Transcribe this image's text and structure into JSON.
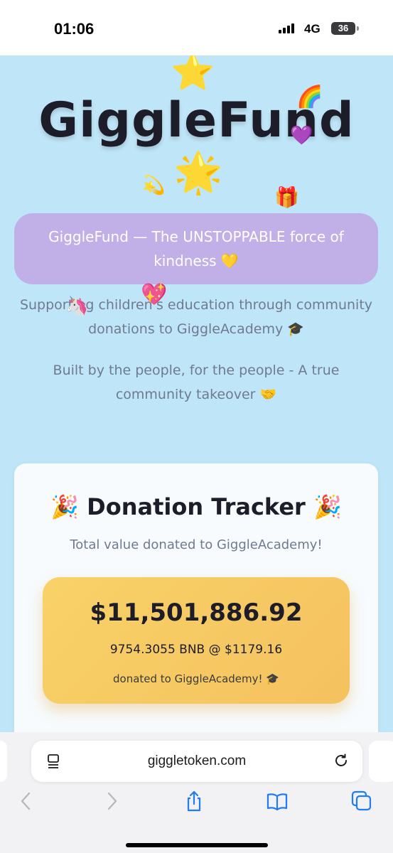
{
  "status_bar": {
    "time": "01:06",
    "network": "4G",
    "battery": "36"
  },
  "hero": {
    "title": "GiggleFund",
    "tagline": "GiggleFund — The UNSTOPPABLE force of kindness 💛",
    "description_1": "Supporting children's education through community donations to GiggleAcademy 🎓",
    "description_2": "Built by the people, for the people - A true community takeover 🤝",
    "decorations": {
      "star_top": "⭐",
      "star_bottom": "🌟",
      "rainbow": "🌈",
      "heart": "💜",
      "comet": "💫",
      "gift": "🎁",
      "unicorn": "🦄",
      "sparkle_heart": "💖"
    }
  },
  "tracker": {
    "party_left": "🎉",
    "title": "Donation Tracker",
    "party_right": "🎉",
    "subtitle": "Total value donated to GiggleAcademy!",
    "amount": "$11,501,886.92",
    "bnb_line": "9754.3055 BNB @ $1179.16",
    "donated_line": "donated to GiggleAcademy! 🎓"
  },
  "browser": {
    "url": "giggletoken.com"
  },
  "colors": {
    "page_background": "#bfe6f8",
    "tagline_pill": "#c1b0e8",
    "amount_box": "#f8d268",
    "title_text": "#1d1d2a",
    "muted_text": "#6f7a8f"
  }
}
